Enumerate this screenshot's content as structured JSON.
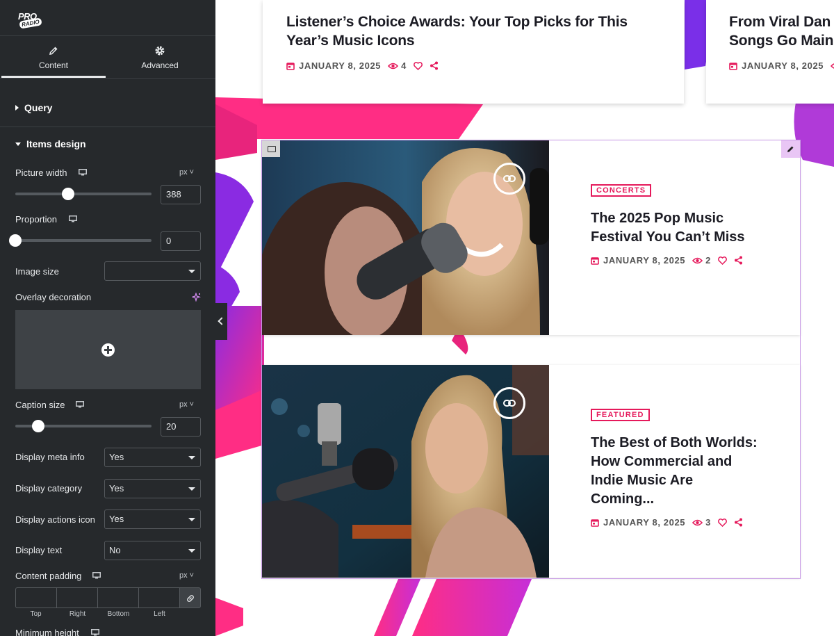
{
  "logo": {
    "line1": "PRO",
    "line2": "RADIO"
  },
  "tabs": [
    {
      "label": "Content",
      "icon": "pencil-icon",
      "active": true
    },
    {
      "label": "Advanced",
      "icon": "gear-icon",
      "active": false
    }
  ],
  "sections": {
    "query": "Query",
    "items_design": "Items design"
  },
  "controls": {
    "picture_width": {
      "label": "Picture width",
      "unit": "px",
      "value": "388",
      "slider_fraction": 0.39
    },
    "proportion": {
      "label": "Proportion",
      "value": "0",
      "slider_fraction": 0.0
    },
    "image_size": {
      "label": "Image size",
      "value": ""
    },
    "overlay_decoration": {
      "label": "Overlay decoration"
    },
    "caption_size": {
      "label": "Caption size",
      "unit": "px",
      "value": "20",
      "slider_fraction": 0.17
    },
    "display_meta_info": {
      "label": "Display meta info",
      "value": "Yes"
    },
    "display_category": {
      "label": "Display category",
      "value": "Yes"
    },
    "display_actions_icon": {
      "label": "Display actions icon",
      "value": "Yes"
    },
    "display_text": {
      "label": "Display text",
      "value": "No"
    },
    "content_padding": {
      "label": "Content padding",
      "unit": "px",
      "sides": [
        "Top",
        "Right",
        "Bottom",
        "Left"
      ]
    },
    "minimum_height": {
      "label": "Minimum height"
    }
  },
  "top_cards": [
    {
      "title_line1": "Listener’s Choice Awards: Your Top Picks for This",
      "title_line2": "Year’s Music Icons",
      "date": "JANUARY 8, 2025",
      "views": "4"
    },
    {
      "title_line1": "From Viral Dan",
      "title_line2": "Songs Go Main",
      "date": "JANUARY 8, 2025",
      "views": ""
    }
  ],
  "posts": [
    {
      "category": "CONCERTS",
      "title": "The 2025 Pop Music Festival You Can’t Miss",
      "date": "JANUARY 8, 2025",
      "views": "2"
    },
    {
      "category": "FEATURED",
      "title": "The Best of Both Worlds: How Commercial and Indie Music Are Coming...",
      "date": "JANUARY 8, 2025",
      "views": "3"
    }
  ],
  "colors": {
    "accent": "#e5195b",
    "panel": "#26292c",
    "purple": "#8a2be2",
    "selection": "#c99ae6"
  }
}
